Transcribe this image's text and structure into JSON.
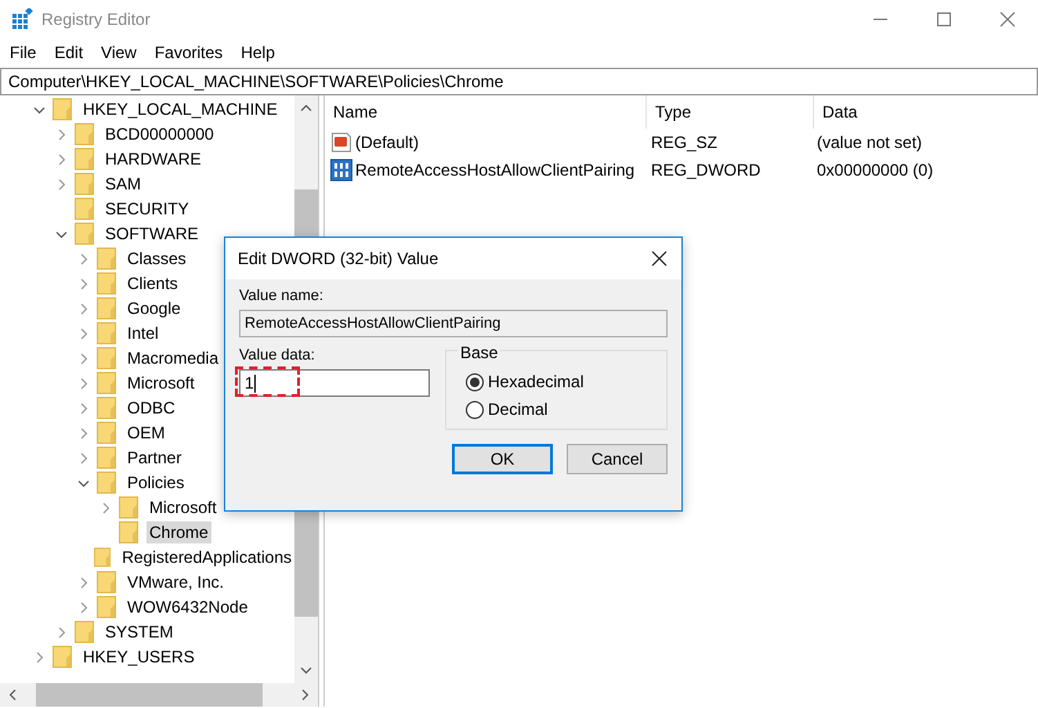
{
  "window": {
    "title": "Registry Editor"
  },
  "menu": [
    "File",
    "Edit",
    "View",
    "Favorites",
    "Help"
  ],
  "address": "Computer\\HKEY_LOCAL_MACHINE\\SOFTWARE\\Policies\\Chrome",
  "tree": [
    {
      "name": "HKEY_LOCAL_MACHINE",
      "expanded": true,
      "selected": false,
      "children": [
        {
          "name": "BCD00000000",
          "expanded": false,
          "selected": false
        },
        {
          "name": "HARDWARE",
          "expanded": false,
          "selected": false
        },
        {
          "name": "SAM",
          "expanded": false,
          "selected": false
        },
        {
          "name": "SECURITY",
          "selected": false
        },
        {
          "name": "SOFTWARE",
          "expanded": true,
          "selected": false,
          "children": [
            {
              "name": "Classes",
              "expanded": false,
              "selected": false
            },
            {
              "name": "Clients",
              "expanded": false,
              "selected": false
            },
            {
              "name": "Google",
              "expanded": false,
              "selected": false
            },
            {
              "name": "Intel",
              "expanded": false,
              "selected": false
            },
            {
              "name": "Macromedia",
              "expanded": false,
              "selected": false
            },
            {
              "name": "Microsoft",
              "expanded": false,
              "selected": false
            },
            {
              "name": "ODBC",
              "expanded": false,
              "selected": false
            },
            {
              "name": "OEM",
              "expanded": false,
              "selected": false
            },
            {
              "name": "Partner",
              "expanded": false,
              "selected": false
            },
            {
              "name": "Policies",
              "expanded": true,
              "selected": false,
              "children": [
                {
                  "name": "Microsoft",
                  "expanded": false,
                  "selected": false
                },
                {
                  "name": "Chrome",
                  "selected": true
                }
              ]
            },
            {
              "name": "RegisteredApplications",
              "selected": false
            },
            {
              "name": "VMware, Inc.",
              "expanded": false,
              "selected": false
            },
            {
              "name": "WOW6432Node",
              "expanded": false,
              "selected": false
            }
          ]
        },
        {
          "name": "SYSTEM",
          "expanded": false,
          "selected": false
        }
      ]
    },
    {
      "name": "HKEY_USERS",
      "expanded": false,
      "selected": false
    }
  ],
  "values": {
    "columns": [
      "Name",
      "Type",
      "Data"
    ],
    "rows": [
      {
        "kind": "string",
        "name": "(Default)",
        "type": "REG_SZ",
        "data": "(value not set)"
      },
      {
        "kind": "binary",
        "name": "RemoteAccessHostAllowClientPairing",
        "type": "REG_DWORD",
        "data": "0x00000000 (0)"
      }
    ]
  },
  "dialog": {
    "title": "Edit DWORD (32-bit) Value",
    "value_name_label": "Value name:",
    "value_name": "RemoteAccessHostAllowClientPairing",
    "value_data_label": "Value data:",
    "value_data": "1",
    "base_label": "Base",
    "bases": [
      {
        "label": "Hexadecimal",
        "selected": true
      },
      {
        "label": "Decimal",
        "selected": false
      }
    ],
    "buttons": [
      {
        "label": "OK",
        "default": true
      },
      {
        "label": "Cancel",
        "default": false
      }
    ]
  }
}
